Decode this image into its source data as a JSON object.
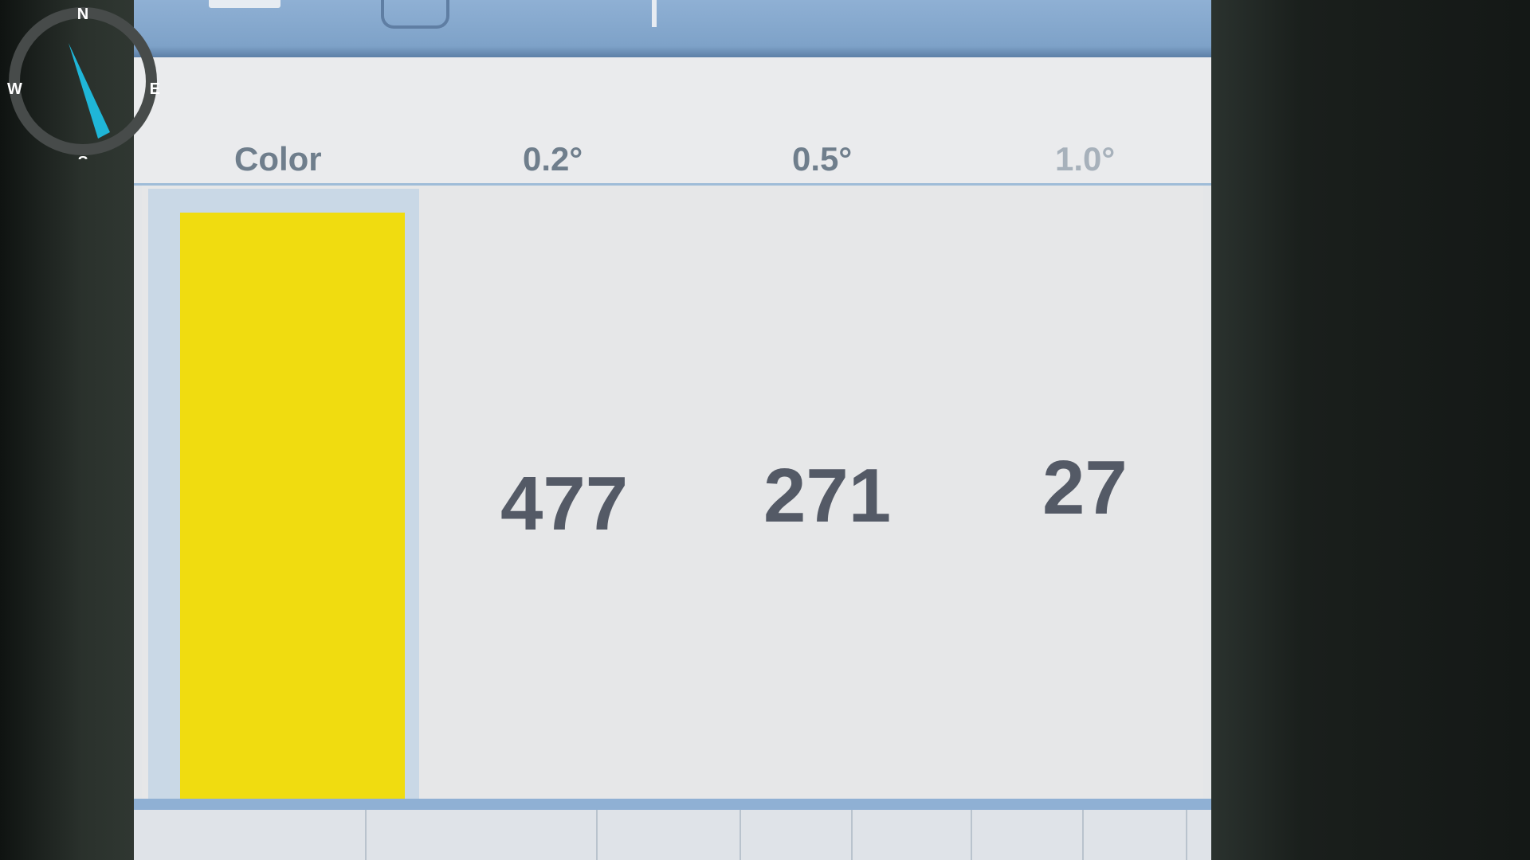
{
  "compass": {
    "north": "N",
    "east": "E",
    "south": "S",
    "west": "W",
    "needle_color": "#1fb6d8"
  },
  "table": {
    "headers": [
      "Color",
      "0.2°",
      "0.5°",
      "1.0°"
    ],
    "swatch_color": "#f0dc10",
    "values": [
      "477",
      "271",
      "27"
    ]
  }
}
